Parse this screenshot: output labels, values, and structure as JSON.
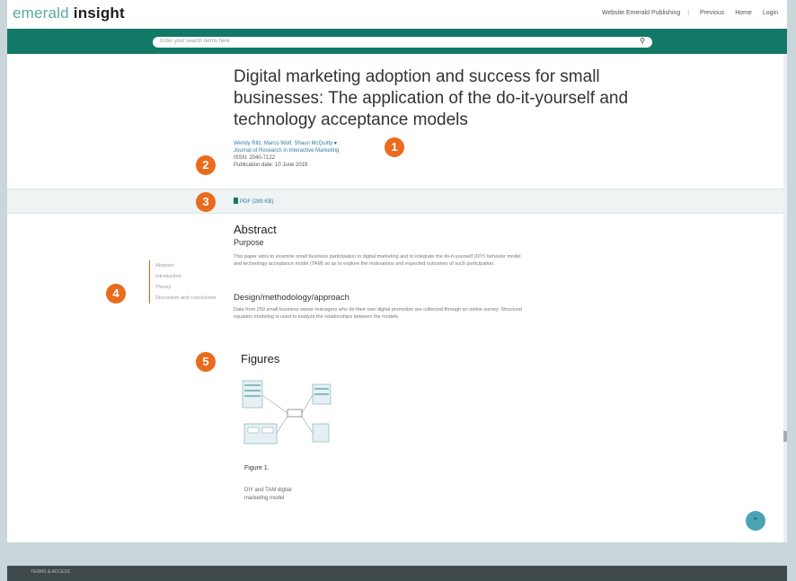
{
  "header": {
    "logo_light": "emerald",
    "logo_bold": "insight",
    "links": [
      "Website Emerald Publishing",
      "Previous",
      "Home",
      "Login"
    ]
  },
  "search": {
    "placeholder": "Enter your search terms here"
  },
  "article": {
    "title": "Digital marketing adoption and success for small businesses: The application of the do-it-yourself and technology acceptance models",
    "authors": "Wendy Ritz, Marco Wolf, Shaun McQuitty",
    "journal": "Journal of Research in Interactive Marketing",
    "issn": "ISSN: 2040-7122",
    "pub_date": "Publication date: 10 June 2019"
  },
  "pdf_link": "PDF (289 KB)",
  "toc": [
    "Abstract",
    "Introduction",
    "Theory",
    "Discussion and conclusions"
  ],
  "abstract": {
    "heading": "Abstract",
    "purpose_heading": "Purpose",
    "purpose_text": "This paper aims to examine small business participation in digital marketing and to integrate the do-it-yourself (DIY) behavior model and technology acceptance model (TAM) so as to explore the motivations and expected outcomes of such participation.",
    "design_heading": "Design/methodology/approach",
    "design_text": "Data from 250 small business owner-managers who do their own digital promotion are collected through an online survey. Structural equation modeling is used to analyze the relationships between the models."
  },
  "figures": {
    "heading": "Figures",
    "caption": "Figure 1.",
    "description": "DIY and TAM digital marketing model"
  },
  "badges": [
    "1",
    "2",
    "3",
    "4",
    "5"
  ],
  "footer": {
    "label": "TERMS & ACCESS"
  },
  "colors": {
    "teal": "#127966",
    "badge": "#ea6b1e",
    "link": "#2c7fa3"
  }
}
